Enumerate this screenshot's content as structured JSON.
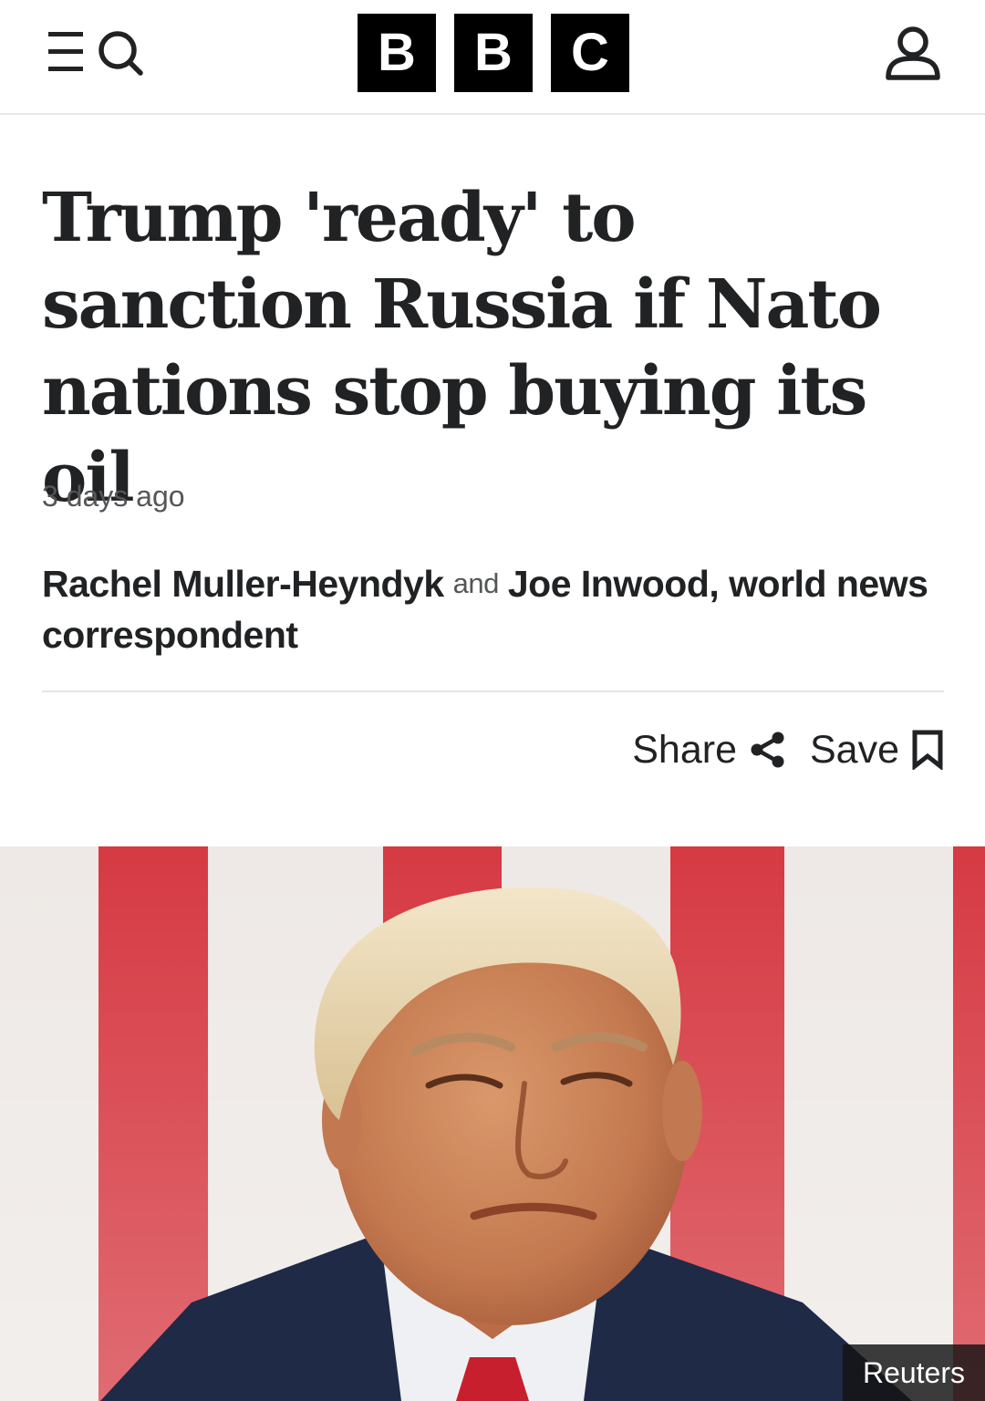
{
  "header": {
    "logo_letters": [
      "B",
      "B",
      "C"
    ],
    "menu_icon": "menu-icon",
    "search_icon": "search-icon",
    "account_icon": "account-icon"
  },
  "article": {
    "headline": "Trump 'ready' to sanction Russia if Nato nations stop buying its oil",
    "timestamp": "3 days ago",
    "byline": {
      "author_1": "Rachel Muller-Heyndyk",
      "conjunction": "and",
      "author_2": "Joe Inwood, world news correspondent"
    },
    "actions": {
      "share_label": "Share",
      "save_label": "Save"
    },
    "hero": {
      "credit": "Reuters"
    }
  },
  "colors": {
    "text": "#202224",
    "muted": "#545658",
    "divider": "#e3e5e7",
    "logo": "#000000"
  }
}
